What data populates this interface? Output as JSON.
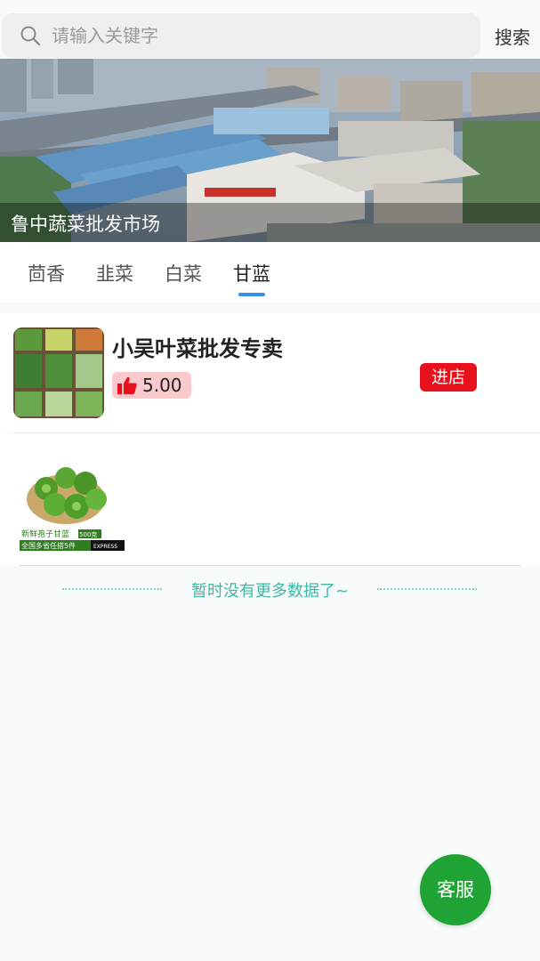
{
  "search": {
    "placeholder": "请输入关键字",
    "button_label": "搜索"
  },
  "banner": {
    "caption": "鲁中蔬菜批发市场"
  },
  "tabs": [
    {
      "label": "茴香",
      "active": false
    },
    {
      "label": "韭菜",
      "active": false
    },
    {
      "label": "白菜",
      "active": false
    },
    {
      "label": "甘蓝",
      "active": true
    }
  ],
  "shop": {
    "name": "小吴叶菜批发专卖",
    "rating": "5.00",
    "enter_label": "进店"
  },
  "product": {
    "image_lines": [
      "新鲜孢子甘蓝",
      "500克",
      "全国多省任搭5件",
      "EXPRESS"
    ]
  },
  "list_end_text": "暂时没有更多数据了~",
  "service_button": "客服",
  "colors": {
    "tab_indicator": "#3a8ee6",
    "enter_button": "#e8101a",
    "rating_badge": "#f9c9cc",
    "service_button": "#1fa334",
    "end_text": "#3fb8a3"
  }
}
